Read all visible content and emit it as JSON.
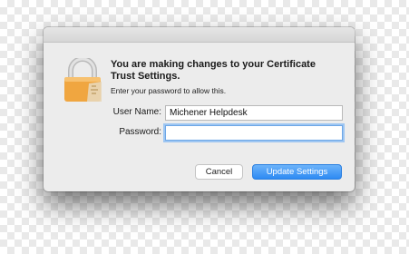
{
  "dialog": {
    "headline": "You are making changes to your Certificate Trust Settings.",
    "subline": "Enter your password to allow this.",
    "username_label": "User Name:",
    "username_value": "Michener Helpdesk",
    "password_label": "Password:",
    "password_value": "",
    "cancel_label": "Cancel",
    "update_label": "Update Settings"
  },
  "icons": {
    "lock": "lock-icon"
  },
  "colors": {
    "primary_button": "#3d94f6",
    "focus_ring": "#9ec6f2",
    "lock_body": "#f0a640",
    "lock_shackle": "#cfcfcf"
  }
}
